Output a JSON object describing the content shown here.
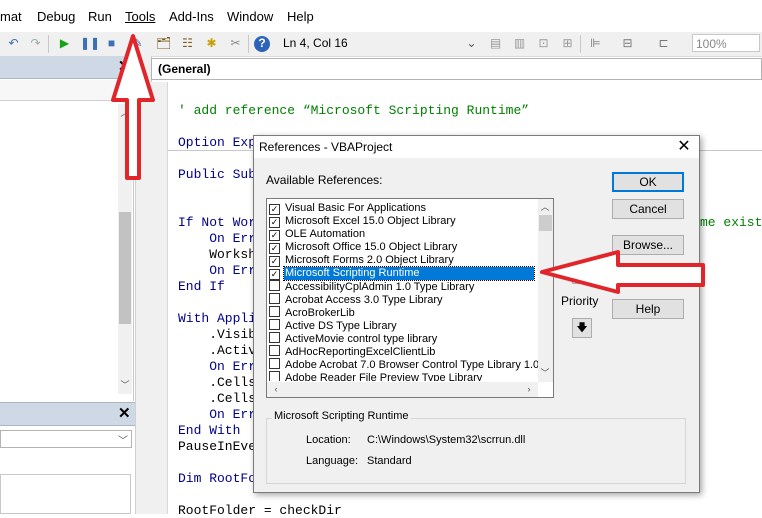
{
  "menubar": {
    "items": [
      "mat",
      "Debug",
      "Run",
      "Tools",
      "Add-Ins",
      "Window",
      "Help"
    ]
  },
  "toolbar": {
    "position": "Ln 4, Col 16",
    "zoom": "100%"
  },
  "code": {
    "object_box": "(General)",
    "lines": [
      {
        "text": "' add reference “Microsoft Scripting Runtime”",
        "comment": true
      },
      {
        "text": "Option Exp"
      },
      {
        "text": "Public Sub"
      },
      {
        "text": "If Not Wor"
      },
      {
        "text": "    On Err"
      },
      {
        "text": "    Worksh"
      },
      {
        "text": "    On Err"
      },
      {
        "text": "End If"
      },
      {
        "text": "With Appli"
      },
      {
        "text": "    .Visib"
      },
      {
        "text": "    .Activ"
      },
      {
        "text": "    On Err"
      },
      {
        "text": "    .Cells"
      },
      {
        "text": "    .Cells"
      },
      {
        "text": "    On Err"
      },
      {
        "text": "End With"
      },
      {
        "text": "PauseInEve"
      },
      {
        "text": "Dim RootFo"
      },
      {
        "text": "RootFolder = checkDir"
      }
    ],
    "right_fragment": "me exist"
  },
  "dialog": {
    "title": "References - VBAProject",
    "available_label": "Available References:",
    "references": [
      {
        "name": "Visual Basic For Applications",
        "checked": true
      },
      {
        "name": "Microsoft Excel 15.0 Object Library",
        "checked": true
      },
      {
        "name": "OLE Automation",
        "checked": true
      },
      {
        "name": "Microsoft Office 15.0 Object Library",
        "checked": true
      },
      {
        "name": "Microsoft Forms 2.0 Object Library",
        "checked": true
      },
      {
        "name": "Microsoft Scripting Runtime",
        "checked": true,
        "selected": true
      },
      {
        "name": "AccessibilityCplAdmin 1.0 Type Library",
        "checked": false
      },
      {
        "name": "Acrobat Access 3.0 Type Library",
        "checked": false
      },
      {
        "name": "AcroBrokerLib",
        "checked": false
      },
      {
        "name": "Active DS Type Library",
        "checked": false
      },
      {
        "name": "ActiveMovie control type library",
        "checked": false
      },
      {
        "name": "AdHocReportingExcelClientLib",
        "checked": false
      },
      {
        "name": "Adobe Acrobat 7.0 Browser Control Type Library 1.0",
        "checked": false
      },
      {
        "name": "Adobe Reader File Preview Type Library",
        "checked": false
      }
    ],
    "buttons": {
      "ok": "OK",
      "cancel": "Cancel",
      "browse": "Browse...",
      "help": "Help"
    },
    "priority_label": "Priority",
    "details": {
      "title": "Microsoft Scripting Runtime",
      "location_label": "Location:",
      "location_value": "C:\\Windows\\System32\\scrrun.dll",
      "language_label": "Language:",
      "language_value": "Standard"
    }
  },
  "colors": {
    "annotation": "#e0252b",
    "selection": "#0078d7",
    "comment": "#008000"
  }
}
